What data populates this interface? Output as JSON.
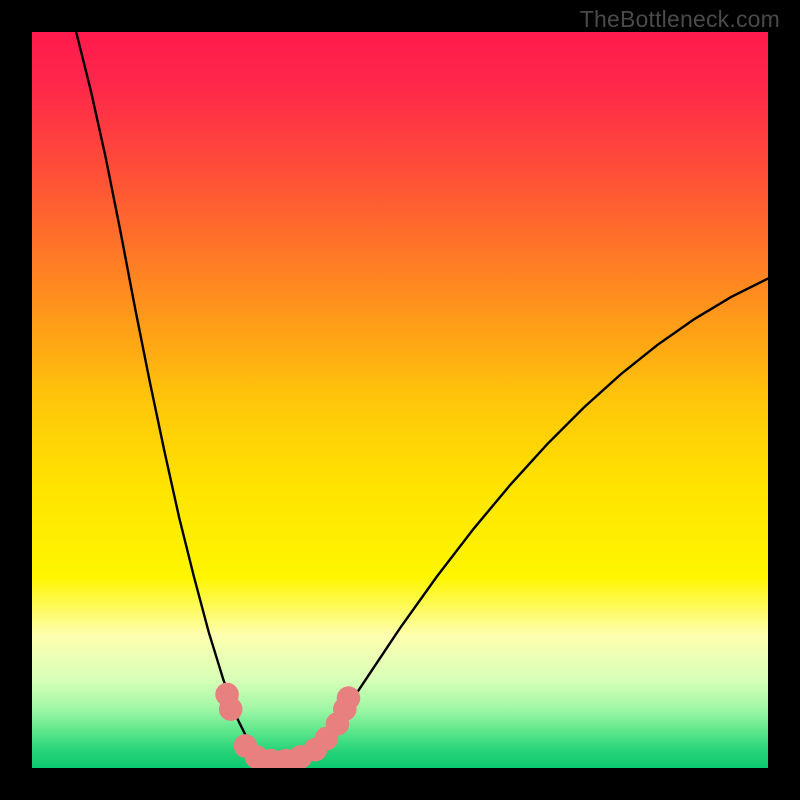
{
  "watermark": "TheBottleneck.com",
  "chart_data": {
    "type": "line",
    "title": "",
    "xlabel": "",
    "ylabel": "",
    "xlim": [
      0,
      100
    ],
    "ylim": [
      0,
      100
    ],
    "background_gradient": {
      "stops": [
        {
          "pos": 0.0,
          "color": "#ff1a4d"
        },
        {
          "pos": 0.08,
          "color": "#ff2a49"
        },
        {
          "pos": 0.2,
          "color": "#ff5236"
        },
        {
          "pos": 0.35,
          "color": "#ff8a1f"
        },
        {
          "pos": 0.5,
          "color": "#ffc60a"
        },
        {
          "pos": 0.62,
          "color": "#ffe400"
        },
        {
          "pos": 0.74,
          "color": "#fff600"
        },
        {
          "pos": 0.82,
          "color": "#fdffb0"
        },
        {
          "pos": 0.88,
          "color": "#d8ffb8"
        },
        {
          "pos": 0.92,
          "color": "#9ff7a5"
        },
        {
          "pos": 0.95,
          "color": "#5ce68c"
        },
        {
          "pos": 0.975,
          "color": "#2bd47a"
        },
        {
          "pos": 1.0,
          "color": "#0ac96e"
        }
      ]
    },
    "series": [
      {
        "name": "bottleneck-curve",
        "color": "#000000",
        "points": [
          {
            "x": 6.0,
            "y": 100.0
          },
          {
            "x": 8.0,
            "y": 92.0
          },
          {
            "x": 10.0,
            "y": 83.0
          },
          {
            "x": 12.0,
            "y": 73.0
          },
          {
            "x": 14.0,
            "y": 62.5
          },
          {
            "x": 16.0,
            "y": 52.5
          },
          {
            "x": 18.0,
            "y": 43.0
          },
          {
            "x": 20.0,
            "y": 34.0
          },
          {
            "x": 22.0,
            "y": 26.0
          },
          {
            "x": 24.0,
            "y": 18.5
          },
          {
            "x": 26.0,
            "y": 12.0
          },
          {
            "x": 28.0,
            "y": 6.5
          },
          {
            "x": 30.0,
            "y": 2.5
          },
          {
            "x": 32.0,
            "y": 0.5
          },
          {
            "x": 34.0,
            "y": 0.0
          },
          {
            "x": 36.0,
            "y": 0.5
          },
          {
            "x": 38.0,
            "y": 2.0
          },
          {
            "x": 40.0,
            "y": 4.5
          },
          {
            "x": 43.0,
            "y": 8.5
          },
          {
            "x": 46.0,
            "y": 13.0
          },
          {
            "x": 50.0,
            "y": 19.0
          },
          {
            "x": 55.0,
            "y": 26.0
          },
          {
            "x": 60.0,
            "y": 32.5
          },
          {
            "x": 65.0,
            "y": 38.5
          },
          {
            "x": 70.0,
            "y": 44.0
          },
          {
            "x": 75.0,
            "y": 49.0
          },
          {
            "x": 80.0,
            "y": 53.5
          },
          {
            "x": 85.0,
            "y": 57.5
          },
          {
            "x": 90.0,
            "y": 61.0
          },
          {
            "x": 95.0,
            "y": 64.0
          },
          {
            "x": 100.0,
            "y": 66.5
          }
        ]
      }
    ],
    "markers": [
      {
        "x": 26.5,
        "y": 10.0,
        "r": 1.6,
        "color": "#e98080"
      },
      {
        "x": 27.0,
        "y": 8.0,
        "r": 1.6,
        "color": "#e98080"
      },
      {
        "x": 29.0,
        "y": 3.0,
        "r": 1.6,
        "color": "#e98080"
      },
      {
        "x": 30.5,
        "y": 1.5,
        "r": 1.6,
        "color": "#e98080"
      },
      {
        "x": 32.5,
        "y": 1.0,
        "r": 1.6,
        "color": "#e98080"
      },
      {
        "x": 34.5,
        "y": 1.0,
        "r": 1.6,
        "color": "#e98080"
      },
      {
        "x": 36.5,
        "y": 1.5,
        "r": 1.6,
        "color": "#e98080"
      },
      {
        "x": 38.5,
        "y": 2.5,
        "r": 1.6,
        "color": "#e98080"
      },
      {
        "x": 40.0,
        "y": 4.0,
        "r": 1.6,
        "color": "#e98080"
      },
      {
        "x": 41.5,
        "y": 6.0,
        "r": 1.6,
        "color": "#e98080"
      },
      {
        "x": 42.5,
        "y": 8.0,
        "r": 1.6,
        "color": "#e98080"
      },
      {
        "x": 43.0,
        "y": 9.5,
        "r": 1.6,
        "color": "#e98080"
      }
    ]
  }
}
